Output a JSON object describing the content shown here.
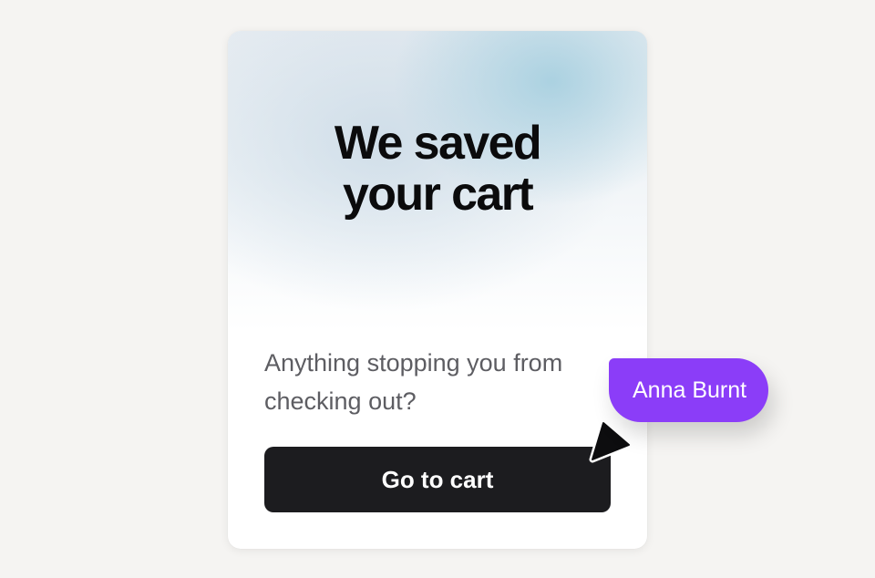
{
  "card": {
    "headline_line1": "We saved",
    "headline_line2": "your cart",
    "body": "Anything stopping you from checking out?",
    "cta_label": "Go to cart"
  },
  "collaborator": {
    "name": "Anna Burnt",
    "tag_color": "#8b3df8",
    "cursor_icon": "pointer-cursor-icon"
  },
  "colors": {
    "background": "#f5f4f2",
    "button": "#1c1c1f",
    "body_text": "#5d5d62"
  }
}
